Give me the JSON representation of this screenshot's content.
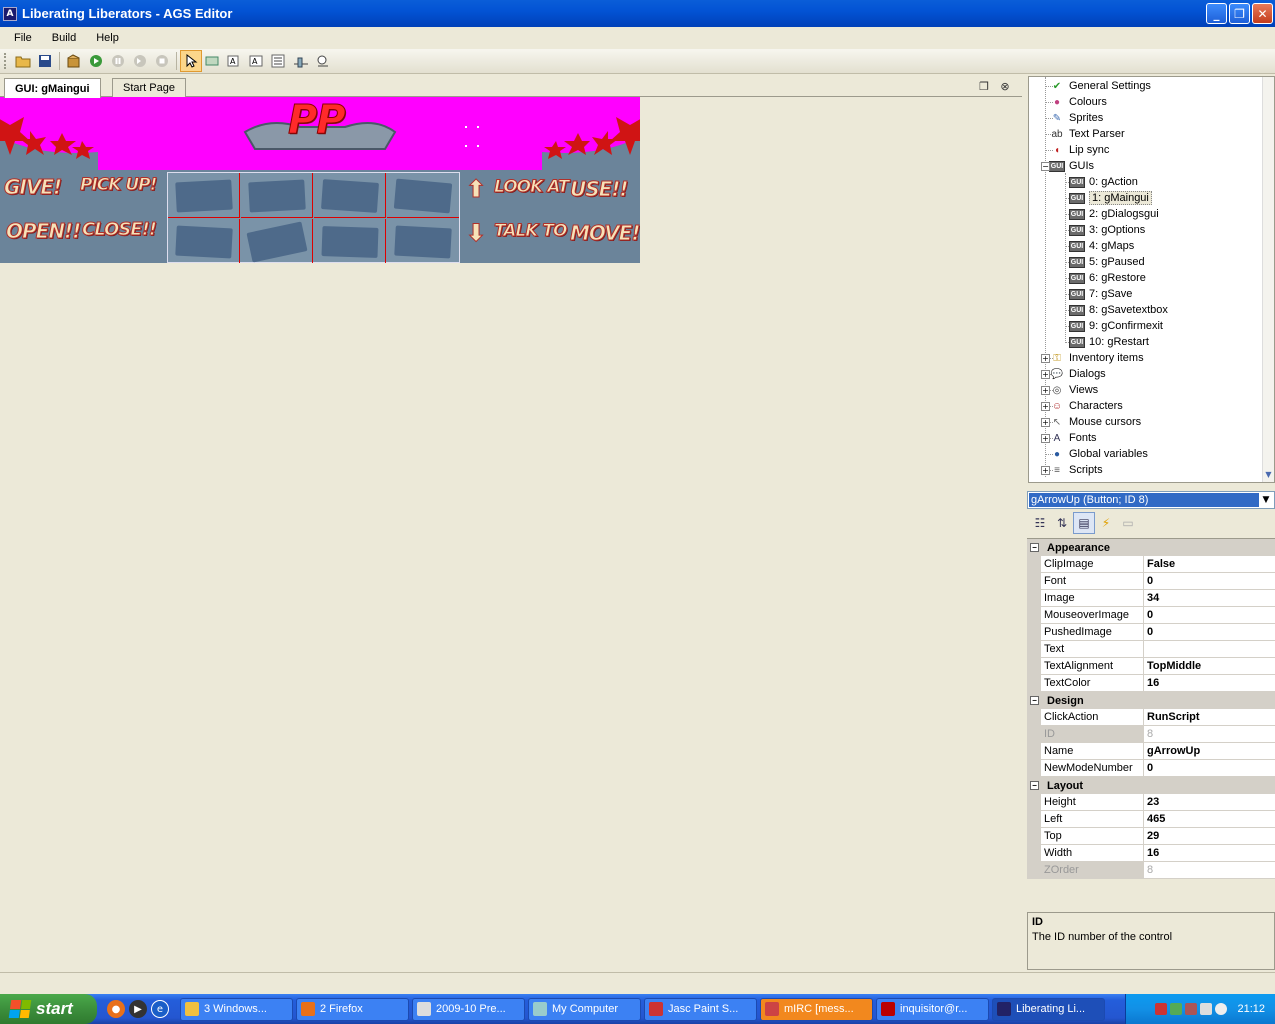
{
  "window": {
    "title": "Liberating Liberators - AGS Editor",
    "app_icon": "ags-icon"
  },
  "menu": [
    "File",
    "Build",
    "Help"
  ],
  "toolbar": {
    "icons": [
      "open-icon",
      "save-icon",
      "build-icon",
      "run-icon",
      "pause-icon",
      "step-icon",
      "stop-icon",
      "select-icon",
      "add-button-icon",
      "add-label-icon",
      "add-textbox-icon",
      "add-listbox-icon",
      "add-slider-icon",
      "add-inventory-icon"
    ]
  },
  "doc_tabs": [
    {
      "label": "GUI: gMaingui",
      "active": true
    },
    {
      "label": "Start Page",
      "active": false
    }
  ],
  "gui_canvas": {
    "logo": "PP",
    "verbs_left": [
      "GIVE!",
      "PICK UP!",
      "OPEN!!",
      "CLOSE!!"
    ],
    "verbs_right": [
      "LOOK AT",
      "USE!!",
      "TALK TO",
      "MOVE!"
    ],
    "arrow_up": "⬆",
    "arrow_down": "⬇",
    "colors": {
      "background": "#ff00ff",
      "panel": "#6b849a"
    }
  },
  "tree": {
    "items": [
      {
        "label": "General Settings",
        "icon": "check-icon"
      },
      {
        "label": "Colours",
        "icon": "palette-icon"
      },
      {
        "label": "Sprites",
        "icon": "sprite-icon"
      },
      {
        "label": "Text Parser",
        "icon": "abc-icon"
      },
      {
        "label": "Lip sync",
        "icon": "lips-icon"
      },
      {
        "label": "GUIs",
        "icon": "gui-icon"
      },
      {
        "label": "0: gAction",
        "icon": "gui-icon"
      },
      {
        "label": "1: gMaingui",
        "icon": "gui-icon",
        "selected": true
      },
      {
        "label": "2: gDialogsgui",
        "icon": "gui-icon"
      },
      {
        "label": "3: gOptions",
        "icon": "gui-icon"
      },
      {
        "label": "4: gMaps",
        "icon": "gui-icon"
      },
      {
        "label": "5: gPaused",
        "icon": "gui-icon"
      },
      {
        "label": "6: gRestore",
        "icon": "gui-icon"
      },
      {
        "label": "7: gSave",
        "icon": "gui-icon"
      },
      {
        "label": "8: gSavetextbox",
        "icon": "gui-icon"
      },
      {
        "label": "9: gConfirmexit",
        "icon": "gui-icon"
      },
      {
        "label": "10: gRestart",
        "icon": "gui-icon"
      },
      {
        "label": "Inventory items",
        "icon": "key-icon"
      },
      {
        "label": "Dialogs",
        "icon": "speech-icon"
      },
      {
        "label": "Views",
        "icon": "glasses-icon"
      },
      {
        "label": "Characters",
        "icon": "people-icon"
      },
      {
        "label": "Mouse cursors",
        "icon": "cursor-icon"
      },
      {
        "label": "Fonts",
        "icon": "font-icon"
      },
      {
        "label": "Global variables",
        "icon": "globe-icon"
      },
      {
        "label": "Scripts",
        "icon": "script-icon"
      }
    ]
  },
  "properties": {
    "selected_object": "gArrowUp (Button; ID 8)",
    "categories": [
      {
        "name": "Appearance",
        "rows": [
          {
            "name": "ClipImage",
            "value": "False"
          },
          {
            "name": "Font",
            "value": "0"
          },
          {
            "name": "Image",
            "value": "34"
          },
          {
            "name": "MouseoverImage",
            "value": "0"
          },
          {
            "name": "PushedImage",
            "value": "0"
          },
          {
            "name": "Text",
            "value": ""
          },
          {
            "name": "TextAlignment",
            "value": "TopMiddle"
          },
          {
            "name": "TextColor",
            "value": "16"
          }
        ]
      },
      {
        "name": "Design",
        "rows": [
          {
            "name": "ClickAction",
            "value": "RunScript"
          },
          {
            "name": "ID",
            "value": "8",
            "disabled": true
          },
          {
            "name": "Name",
            "value": "gArrowUp"
          },
          {
            "name": "NewModeNumber",
            "value": "0"
          }
        ]
      },
      {
        "name": "Layout",
        "rows": [
          {
            "name": "Height",
            "value": "23"
          },
          {
            "name": "Left",
            "value": "465"
          },
          {
            "name": "Top",
            "value": "29"
          },
          {
            "name": "Width",
            "value": "16"
          },
          {
            "name": "ZOrder",
            "value": "8",
            "disabled": true
          }
        ]
      }
    ],
    "description": {
      "title": "ID",
      "text": "The ID number of the control"
    }
  },
  "taskbar": {
    "start_label": "start",
    "tasks": [
      {
        "label": "3 Windows...",
        "icon": "explorer-icon"
      },
      {
        "label": "2 Firefox",
        "icon": "firefox-icon"
      },
      {
        "label": "2009-10 Pre...",
        "icon": "document-icon"
      },
      {
        "label": "My Computer",
        "icon": "computer-icon"
      },
      {
        "label": "Jasc Paint S...",
        "icon": "paint-icon"
      },
      {
        "label": "mIRC [mess...",
        "icon": "mirc-icon",
        "flash": true
      },
      {
        "label": "inquisitor@r...",
        "icon": "filezilla-icon"
      },
      {
        "label": "Liberating Li...",
        "icon": "ags-icon",
        "pressed": true
      }
    ],
    "clock": "21:12"
  }
}
